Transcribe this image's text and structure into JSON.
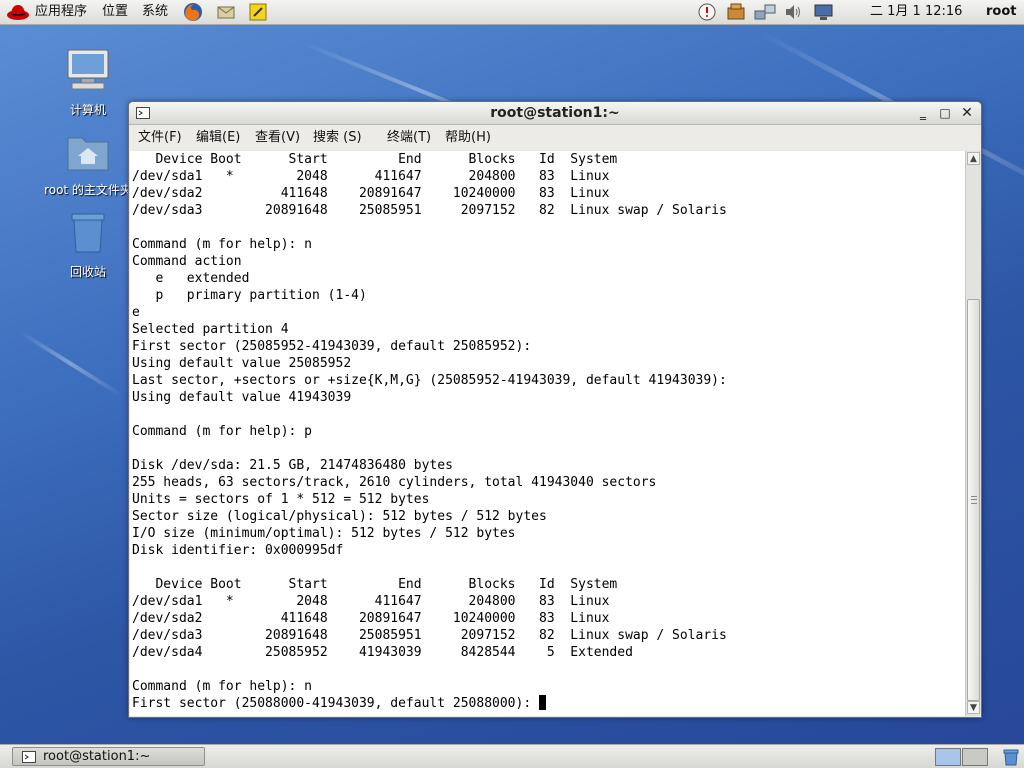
{
  "top_panel": {
    "menus": [
      "应用程序",
      "位置",
      "系统"
    ],
    "clock": "二 1月  1 12:16",
    "user": "root"
  },
  "desktop_icons": [
    {
      "label": "计算机",
      "icon": "computer-icon"
    },
    {
      "label": "root 的主文件夹",
      "icon": "home-folder-icon"
    },
    {
      "label": "回收站",
      "icon": "trash-icon"
    }
  ],
  "window": {
    "title": "root@station1:~",
    "menus": [
      "文件(F)",
      "编辑(E)",
      "查看(V)",
      "搜索 (S)",
      "终端(T)",
      "帮助(H)"
    ],
    "terminal_lines": [
      "   Device Boot      Start         End      Blocks   Id  System",
      "/dev/sda1   *        2048      411647      204800   83  Linux",
      "/dev/sda2          411648    20891647    10240000   83  Linux",
      "/dev/sda3        20891648    25085951     2097152   82  Linux swap / Solaris",
      "",
      "Command (m for help): n",
      "Command action",
      "   e   extended",
      "   p   primary partition (1-4)",
      "e",
      "Selected partition 4",
      "First sector (25085952-41943039, default 25085952):",
      "Using default value 25085952",
      "Last sector, +sectors or +size{K,M,G} (25085952-41943039, default 41943039):",
      "Using default value 41943039",
      "",
      "Command (m for help): p",
      "",
      "Disk /dev/sda: 21.5 GB, 21474836480 bytes",
      "255 heads, 63 sectors/track, 2610 cylinders, total 41943040 sectors",
      "Units = sectors of 1 * 512 = 512 bytes",
      "Sector size (logical/physical): 512 bytes / 512 bytes",
      "I/O size (minimum/optimal): 512 bytes / 512 bytes",
      "Disk identifier: 0x000995df",
      "",
      "   Device Boot      Start         End      Blocks   Id  System",
      "/dev/sda1   *        2048      411647      204800   83  Linux",
      "/dev/sda2          411648    20891647    10240000   83  Linux",
      "/dev/sda3        20891648    25085951     2097152   82  Linux swap / Solaris",
      "/dev/sda4        25085952    41943039     8428544    5  Extended",
      "",
      "Command (m for help): n"
    ],
    "prompt_line": "First sector (25088000-41943039, default 25088000): "
  },
  "taskbar": {
    "task_label": "root@station1:~"
  },
  "colors": {
    "desktop": "#3e6fbf",
    "terminal_bg": "#ffffff",
    "terminal_fg": "#000000"
  }
}
